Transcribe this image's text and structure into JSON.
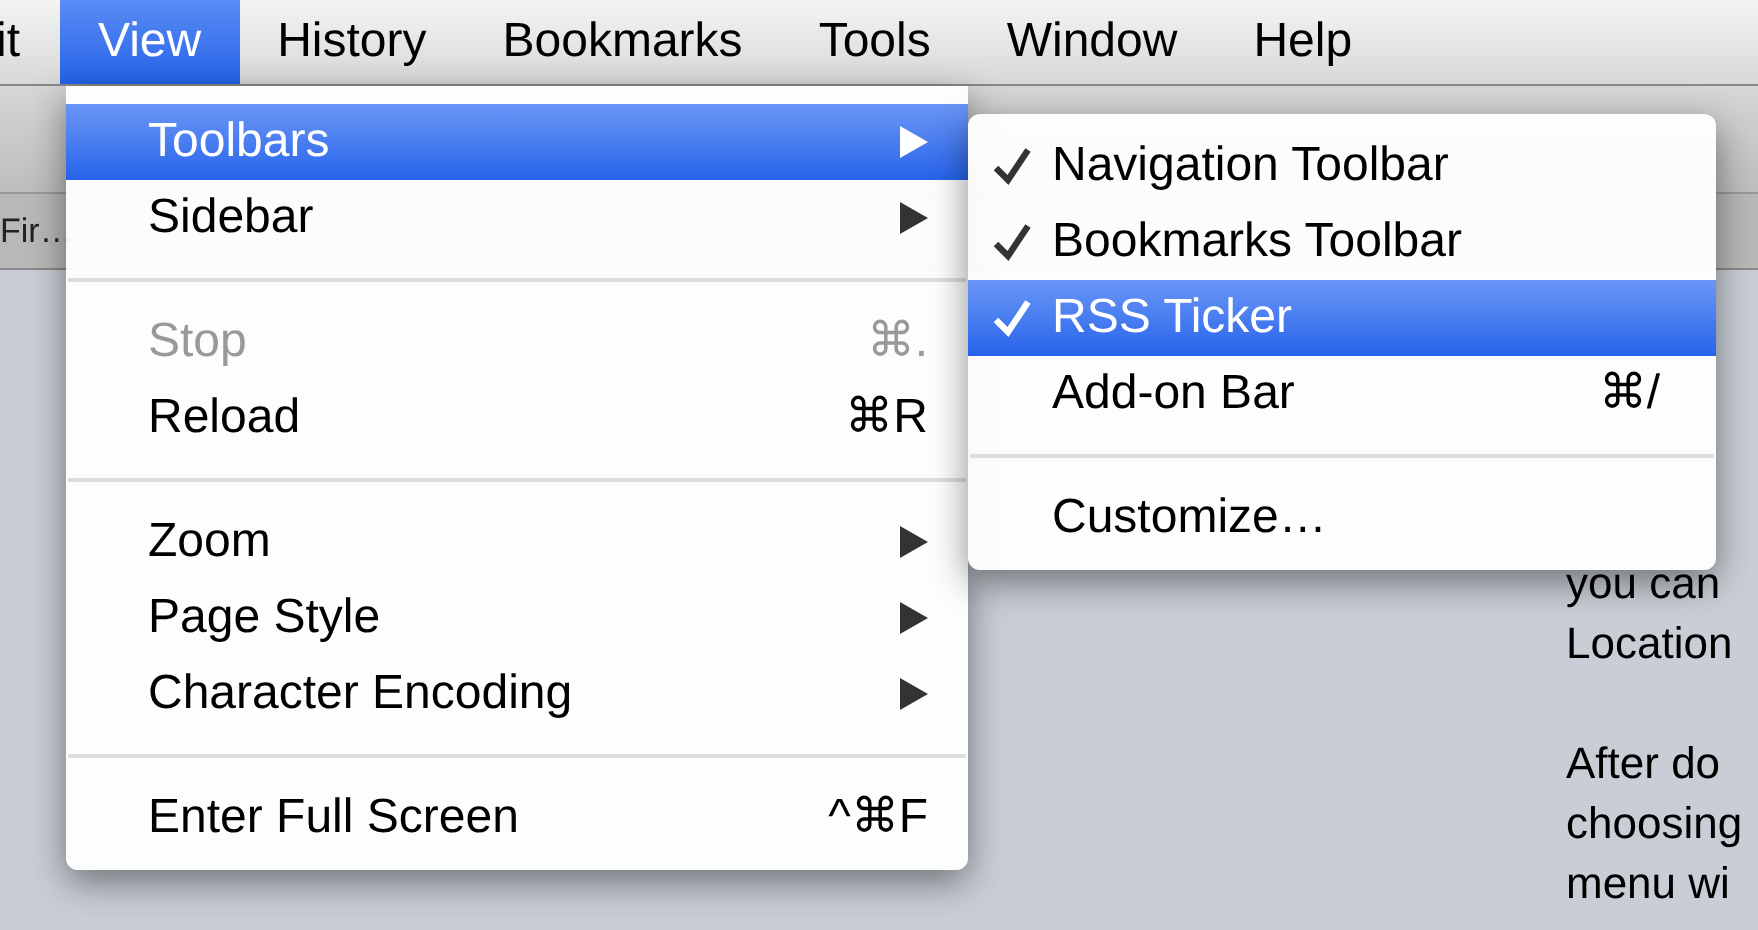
{
  "menu_bar": [
    {
      "label": "it",
      "selected": false
    },
    {
      "label": "View",
      "selected": true
    },
    {
      "label": "History",
      "selected": false
    },
    {
      "label": "Bookmarks",
      "selected": false
    },
    {
      "label": "Tools",
      "selected": false
    },
    {
      "label": "Window",
      "selected": false
    },
    {
      "label": "Help",
      "selected": false
    }
  ],
  "background": {
    "tab": "Fir…",
    "paragraphs": [
      [
        "you can",
        "Location"
      ],
      [
        "After do",
        "choosing",
        "menu wi"
      ]
    ]
  },
  "view_menu": [
    {
      "kind": "item",
      "label": "Toolbars",
      "submenu": true,
      "selected": true,
      "disabled": false
    },
    {
      "kind": "item",
      "label": "Sidebar",
      "submenu": true,
      "selected": false,
      "disabled": false
    },
    {
      "kind": "separator"
    },
    {
      "kind": "item",
      "label": "Stop",
      "shortcut": "⌘.",
      "selected": false,
      "disabled": true
    },
    {
      "kind": "item",
      "label": "Reload",
      "shortcut": "⌘R",
      "selected": false,
      "disabled": false
    },
    {
      "kind": "separator"
    },
    {
      "kind": "item",
      "label": "Zoom",
      "submenu": true,
      "selected": false,
      "disabled": false
    },
    {
      "kind": "item",
      "label": "Page Style",
      "submenu": true,
      "selected": false,
      "disabled": false
    },
    {
      "kind": "item",
      "label": "Character Encoding",
      "submenu": true,
      "selected": false,
      "disabled": false
    },
    {
      "kind": "separator"
    },
    {
      "kind": "item",
      "label": "Enter Full Screen",
      "shortcut": "^⌘F",
      "selected": false,
      "disabled": false
    }
  ],
  "toolbars_submenu": [
    {
      "kind": "item",
      "label": "Navigation Toolbar",
      "checked": true,
      "selected": false
    },
    {
      "kind": "item",
      "label": "Bookmarks Toolbar",
      "checked": true,
      "selected": false
    },
    {
      "kind": "item",
      "label": "RSS Ticker",
      "checked": true,
      "selected": true
    },
    {
      "kind": "item",
      "label": "Add-on Bar",
      "shortcut": "⌘/",
      "checked": false,
      "selected": false
    },
    {
      "kind": "separator"
    },
    {
      "kind": "item",
      "label": "Customize…",
      "checked": false,
      "selected": false
    }
  ]
}
